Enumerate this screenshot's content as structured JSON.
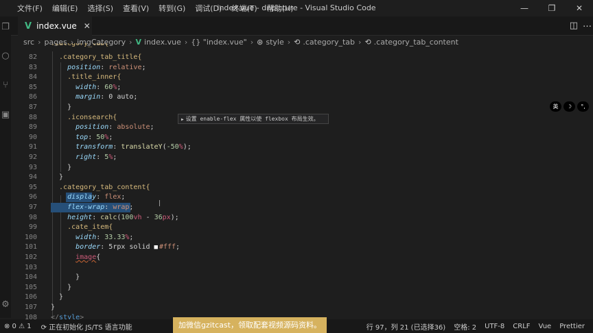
{
  "menu": [
    "文件(F)",
    "编辑(E)",
    "选择(S)",
    "查看(V)",
    "转到(G)",
    "调试(D)",
    "终端(T)",
    "帮助(H)"
  ],
  "window_title": "index.vue - dnpicture - Visual Studio Code",
  "window_controls": {
    "minimize": "—",
    "maximize": "❐",
    "close": "✕"
  },
  "tab": {
    "icon": "V",
    "label": "index.vue",
    "close": "✕"
  },
  "breadcrumb": {
    "src": "src",
    "pages": "pages",
    "imgCategory": "imgCategory",
    "file": "index.vue",
    "json_label": "{} \"index.vue\"",
    "style": "style",
    "sel1": ".category_tab",
    "sel2": ".category_tab_content"
  },
  "editor": {
    "partial_top": ".category_tab{",
    "lines": [
      {
        "n": "82",
        "tokens": [
          [
            "  .category_tab_title{",
            "sel"
          ]
        ]
      },
      {
        "n": "83",
        "tokens": [
          [
            "    position",
            "prop"
          ],
          [
            ": ",
            "kw"
          ],
          [
            "relative",
            "val"
          ],
          [
            ";",
            "kw"
          ]
        ]
      },
      {
        "n": "84",
        "tokens": [
          [
            "    .title_inner{",
            "sel"
          ]
        ]
      },
      {
        "n": "85",
        "tokens": [
          [
            "      width",
            "prop"
          ],
          [
            ": ",
            "kw"
          ],
          [
            "60",
            "num"
          ],
          [
            "%",
            "unit"
          ],
          [
            ";",
            "kw"
          ]
        ]
      },
      {
        "n": "86",
        "tokens": [
          [
            "      margin",
            "prop"
          ],
          [
            ": ",
            "kw"
          ],
          [
            "0 auto",
            "kw"
          ],
          [
            ";",
            "kw"
          ]
        ]
      },
      {
        "n": "87",
        "tokens": [
          [
            "    }",
            "brace"
          ]
        ]
      },
      {
        "n": "88",
        "tokens": [
          [
            "    .iconsearch{",
            "sel"
          ]
        ]
      },
      {
        "n": "89",
        "tokens": [
          [
            "      position",
            "prop"
          ],
          [
            ": ",
            "kw"
          ],
          [
            "absolute",
            "val"
          ],
          [
            ";",
            "kw"
          ]
        ]
      },
      {
        "n": "90",
        "tokens": [
          [
            "      top",
            "prop"
          ],
          [
            ": ",
            "kw"
          ],
          [
            "50",
            "num"
          ],
          [
            "%",
            "unit"
          ],
          [
            ";",
            "kw"
          ]
        ]
      },
      {
        "n": "91",
        "tokens": [
          [
            "      transform",
            "prop"
          ],
          [
            ": ",
            "kw"
          ],
          [
            "translateY",
            "fn"
          ],
          [
            "(",
            "kw"
          ],
          [
            "-50",
            "num"
          ],
          [
            "%",
            "unit"
          ],
          [
            ");",
            "kw"
          ]
        ]
      },
      {
        "n": "92",
        "tokens": [
          [
            "      right",
            "prop"
          ],
          [
            ": ",
            "kw"
          ],
          [
            "5",
            "num"
          ],
          [
            "%",
            "unit"
          ],
          [
            ";",
            "kw"
          ]
        ]
      },
      {
        "n": "93",
        "tokens": [
          [
            "    }",
            "brace"
          ]
        ]
      },
      {
        "n": "94",
        "tokens": [
          [
            "  }",
            "brace"
          ]
        ]
      },
      {
        "n": "95",
        "tokens": [
          [
            "  .category_tab_content{",
            "sel"
          ]
        ]
      },
      {
        "n": "96",
        "tokens": [
          [
            "    display",
            "prop"
          ],
          [
            ": ",
            "kw"
          ],
          [
            "flex",
            "val"
          ],
          [
            ";",
            "kw"
          ]
        ]
      },
      {
        "n": "97",
        "tokens": [
          [
            "    flex-wrap",
            "prop"
          ],
          [
            ": ",
            "kw"
          ],
          [
            "wrap",
            "val"
          ],
          [
            ";",
            "kw"
          ]
        ]
      },
      {
        "n": "98",
        "tokens": [
          [
            "    height",
            "prop"
          ],
          [
            ": ",
            "kw"
          ],
          [
            "calc",
            "fn"
          ],
          [
            "(",
            "kw"
          ],
          [
            "100",
            "num"
          ],
          [
            "vh",
            "unit"
          ],
          [
            " - ",
            "kw"
          ],
          [
            "36",
            "num"
          ],
          [
            "px",
            "unit"
          ],
          [
            ");",
            "kw"
          ]
        ]
      },
      {
        "n": "99",
        "tokens": [
          [
            "    .cate_item{",
            "sel"
          ]
        ]
      },
      {
        "n": "100",
        "tokens": [
          [
            "      width",
            "prop"
          ],
          [
            ": ",
            "kw"
          ],
          [
            "33.33",
            "num"
          ],
          [
            "%",
            "unit"
          ],
          [
            ";",
            "kw"
          ]
        ]
      },
      {
        "n": "101",
        "tokens": [
          [
            "      border",
            "prop"
          ],
          [
            ": ",
            "kw"
          ],
          [
            "5rpx solid ",
            "kw"
          ],
          [
            "■",
            "swatch"
          ],
          [
            "#fff",
            "val"
          ],
          [
            ";",
            "kw"
          ]
        ]
      },
      {
        "n": "102",
        "tokens": [
          [
            "      ",
            "kw"
          ],
          [
            "image",
            "err"
          ],
          [
            "{",
            "brace"
          ]
        ]
      },
      {
        "n": "103",
        "tokens": []
      },
      {
        "n": "104",
        "tokens": [
          [
            "      }",
            "brace"
          ]
        ]
      },
      {
        "n": "105",
        "tokens": [
          [
            "    }",
            "brace"
          ]
        ]
      },
      {
        "n": "106",
        "tokens": [
          [
            "  }",
            "brace"
          ]
        ]
      },
      {
        "n": "107",
        "tokens": [
          [
            "}",
            "brace"
          ]
        ]
      },
      {
        "n": "108",
        "tokens": [
          [
            "</",
            "punc"
          ],
          [
            "style",
            "tag"
          ],
          [
            ">",
            "punc"
          ]
        ]
      }
    ]
  },
  "hover": {
    "arrow": "▶",
    "text": "设置 enable-flex 属性以使 flexbox 布局生效。"
  },
  "ime": [
    "英",
    "☽",
    "°,"
  ],
  "status": {
    "problems": "⊗ 0 ⚠ 1",
    "init": "⟳ 正在初始化 JS/TS 语言功能",
    "watermark": "加微信gzitcast，领取配套视频源码资料。",
    "position": "行 97，列 21 (已选择36)",
    "spaces": "空格: 2",
    "encoding": "UTF-8",
    "eol": "CRLF",
    "language": "Vue",
    "formatter": "Prettier"
  },
  "colors": {
    "selection": "#264f78",
    "vue_green": "#41b883",
    "watermark_bg": "#d6b25e"
  }
}
